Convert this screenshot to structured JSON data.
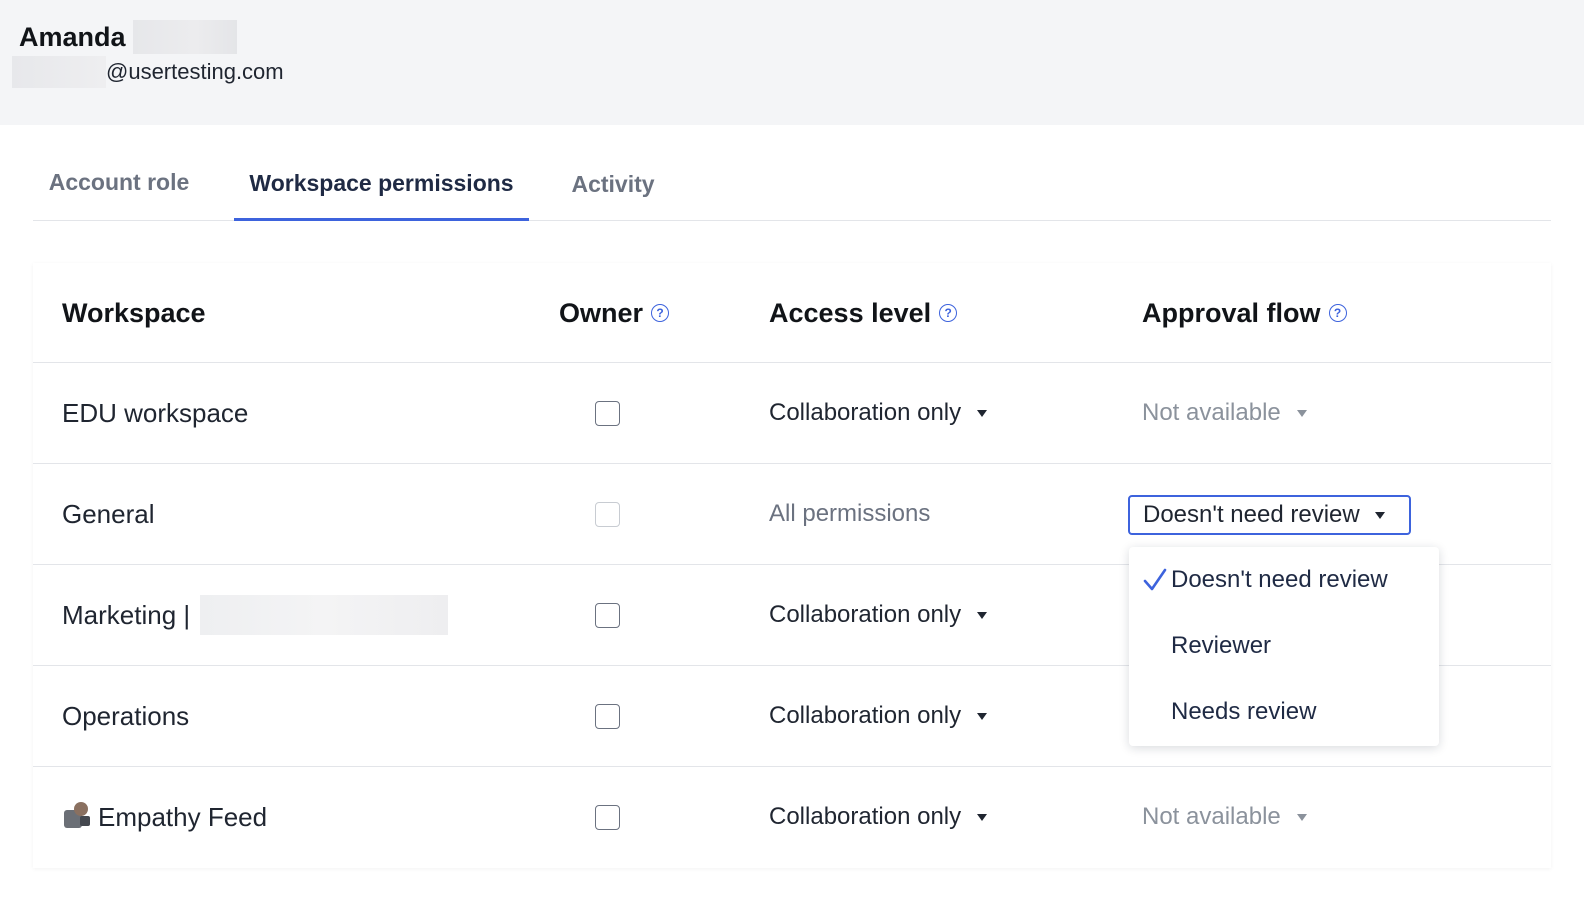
{
  "user": {
    "first_name": "Amanda",
    "email_domain": "@usertesting.com"
  },
  "tabs": [
    {
      "label": "Account role",
      "active": false
    },
    {
      "label": "Workspace permissions",
      "active": true
    },
    {
      "label": "Activity",
      "active": false
    }
  ],
  "table": {
    "headers": {
      "workspace": "Workspace",
      "owner": "Owner",
      "access_level": "Access level",
      "approval_flow": "Approval flow"
    },
    "help_glyph": "?",
    "rows": [
      {
        "name": "EDU workspace",
        "owner_checked": false,
        "owner_disabled": false,
        "access": "Collaboration only",
        "approval": "Not available"
      },
      {
        "name": "General",
        "owner_checked": false,
        "owner_disabled": true,
        "access": "All permissions",
        "approval": "Doesn't need review"
      },
      {
        "name": "Marketing |",
        "owner_checked": false,
        "owner_disabled": false,
        "access": "Collaboration only",
        "approval": ""
      },
      {
        "name": "Operations",
        "owner_checked": false,
        "owner_disabled": false,
        "access": "Collaboration only",
        "approval": ""
      },
      {
        "name": "Empathy Feed",
        "owner_checked": false,
        "owner_disabled": false,
        "access": "Collaboration only",
        "approval": "Not available",
        "icon": "film-projector-icon"
      }
    ]
  },
  "approval_dropdown": {
    "options": [
      "Doesn't need review",
      "Reviewer",
      "Needs review"
    ],
    "selected": "Doesn't need review"
  },
  "colors": {
    "accent": "#3d63dd",
    "header_bg": "#f4f5f7",
    "muted_text": "#8b929c"
  }
}
